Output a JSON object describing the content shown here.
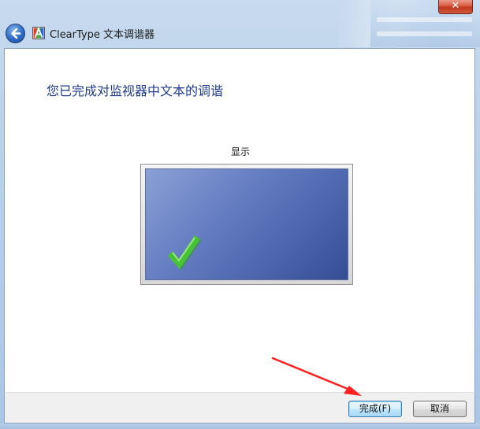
{
  "window": {
    "title": "ClearType 文本调谐器",
    "close_label": "✕"
  },
  "content": {
    "heading": "您已完成对监视器中文本的调谐",
    "monitor_label": "显示"
  },
  "footer": {
    "finish_label": "完成(F)",
    "cancel_label": "取消"
  },
  "colors": {
    "heading": "#1e3a8a",
    "check": "#3cae2c",
    "annotation_arrow": "#ff2020"
  },
  "icons": {
    "back": "back-arrow-icon",
    "app": "cleartype-icon",
    "check": "checkmark-icon",
    "close": "close-icon"
  }
}
